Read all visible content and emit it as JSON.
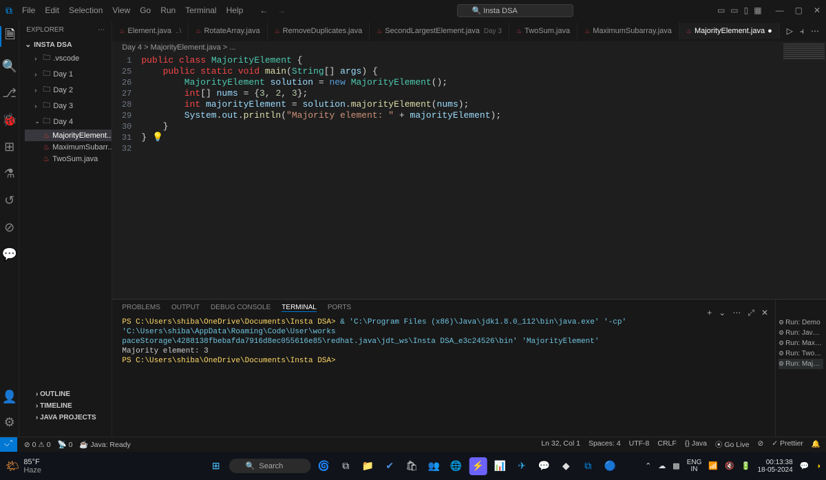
{
  "titlebar": {
    "menu": [
      "File",
      "Edit",
      "Selection",
      "View",
      "Go",
      "Run",
      "Terminal",
      "Help"
    ],
    "search": "Insta DSA"
  },
  "sidebar": {
    "header": "EXPLORER",
    "project": "INSTA DSA",
    "folders": [
      {
        "name": ".vscode",
        "open": false
      },
      {
        "name": "Day 1",
        "open": false
      },
      {
        "name": "Day 2",
        "open": false
      },
      {
        "name": "Day 3",
        "open": false
      },
      {
        "name": "Day 4",
        "open": true,
        "children": [
          "MajorityElement...",
          "MaximumSubarr...",
          "TwoSum.java"
        ]
      }
    ],
    "bottom": [
      "OUTLINE",
      "TIMELINE",
      "JAVA PROJECTS"
    ]
  },
  "tabs": [
    {
      "label": "Element.java",
      "desc": "..\\"
    },
    {
      "label": "RotateArray.java"
    },
    {
      "label": "RemoveDuplicates.java"
    },
    {
      "label": "SecondLargestElement.java",
      "desc": "Day 3"
    },
    {
      "label": "TwoSum.java"
    },
    {
      "label": "MaximumSubarray.java"
    },
    {
      "label": "MajorityElement.java",
      "active": true,
      "dirty": true
    }
  ],
  "breadcrumb": "Day 4 > MajorityElement.java > ...",
  "code": {
    "lines": [
      {
        "n": 1,
        "html": "<span class='kw-red'>public</span> <span class='kw-red'>class</span> <span class='type'>MajorityElement</span> <span class='pn'>{</span>"
      },
      {
        "n": 25,
        "html": "    <span class='kw-red'>public</span> <span class='kw-red'>static</span> <span class='kw-red'>void</span> <span class='fn'>main</span><span class='pn'>(</span><span class='type'>String</span><span class='pn'>[]</span> <span class='var'>args</span><span class='pn'>) {</span>"
      },
      {
        "n": 26,
        "html": "        <span class='type'>MajorityElement</span> <span class='var'>solution</span> <span class='pn'>=</span> <span class='kw-blue'>new</span> <span class='type'>MajorityElement</span><span class='pn'>();</span>"
      },
      {
        "n": 27,
        "html": "        <span class='kw-red'>int</span><span class='pn'>[]</span> <span class='var'>nums</span> <span class='pn'>= {</span><span class='num'>3</span><span class='pn'>,</span> <span class='num'>2</span><span class='pn'>,</span> <span class='num'>3</span><span class='pn'>};</span>"
      },
      {
        "n": 28,
        "html": "        <span class='kw-red'>int</span> <span class='var'>majorityElement</span> <span class='pn'>=</span> <span class='var'>solution</span><span class='pn'>.</span><span class='fn'>majorityElement</span><span class='pn'>(</span><span class='var'>nums</span><span class='pn'>);</span>"
      },
      {
        "n": 29,
        "html": "        <span class='var'>System</span><span class='pn'>.</span><span class='var'>out</span><span class='pn'>.</span><span class='fn'>println</span><span class='pn'>(</span><span class='str'>\"Majority element: \"</span> <span class='pn'>+</span> <span class='var'>majorityElement</span><span class='pn'>);</span>"
      },
      {
        "n": 30,
        "html": "    <span class='pn'>}</span>"
      },
      {
        "n": 31,
        "html": "<span class='pn'>}</span> <span style='color:#cca700'>💡</span>"
      },
      {
        "n": 32,
        "html": ""
      }
    ]
  },
  "panel": {
    "tabs": [
      "PROBLEMS",
      "OUTPUT",
      "DEBUG CONSOLE",
      "TERMINAL",
      "PORTS"
    ],
    "active": 3,
    "terminal": {
      "l1a": "PS C:\\Users\\shiba\\OneDrive\\Documents\\Insta DSA> ",
      "l1b": "& 'C:\\Program Files (x86)\\Java\\jdk1.8.0_112\\bin\\java.exe' '-cp' 'C:\\Users\\shiba\\AppData\\Roaming\\Code\\User\\works",
      "l2": "paceStorage\\4288138fbebafda7916d8ec055616e85\\redhat.java\\jdt_ws\\Insta DSA_e3c24526\\bin' 'MajorityElement'",
      "l3": "Majority element: 3",
      "l4": "PS C:\\Users\\shiba\\OneDrive\\Documents\\Insta DSA> "
    },
    "runs": [
      "Run: Demo",
      "Run: JavaFo...",
      "Run: Maxim...",
      "Run: TwoSum",
      "Run: Majorit..."
    ]
  },
  "status": {
    "errors": "0",
    "warnings": "0",
    "ports": "0",
    "java": "Java: Ready",
    "pos": "Ln 32, Col 1",
    "spaces": "Spaces: 4",
    "enc": "UTF-8",
    "eol": "CRLF",
    "lang": "{} Java",
    "golive": "⦿ Go Live",
    "prettier": "✓ Prettier"
  },
  "taskbar": {
    "temp": "85°F",
    "weather": "Haze",
    "search": "Search",
    "lang1": "ENG",
    "lang2": "IN",
    "time": "00:13:38",
    "date": "18-05-2024"
  }
}
